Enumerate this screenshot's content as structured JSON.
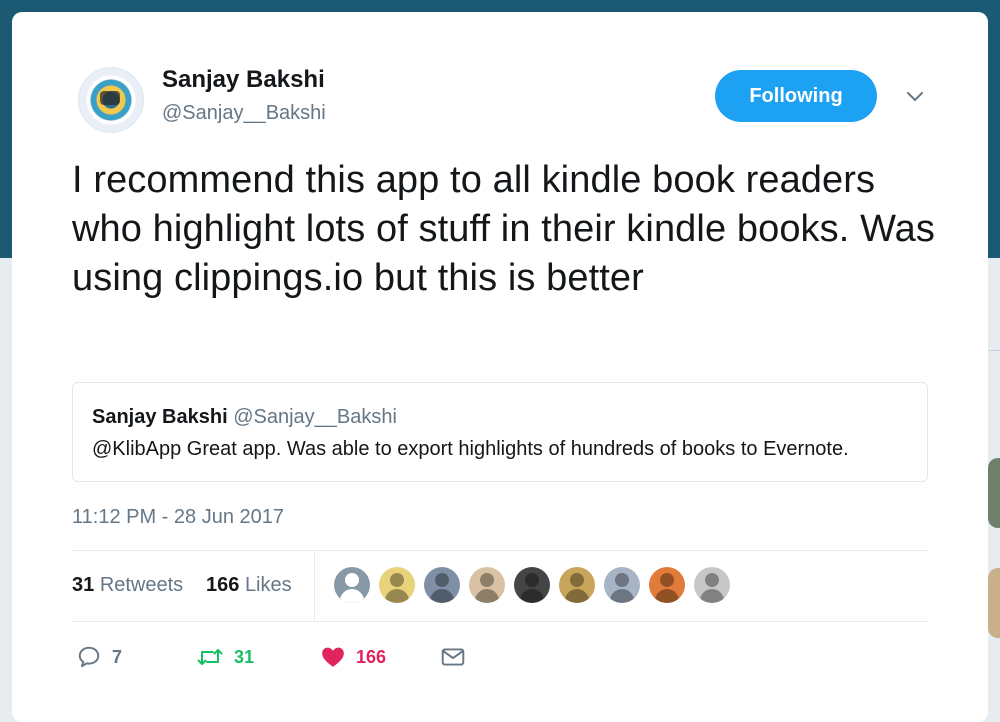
{
  "tweet": {
    "author": {
      "name": "Sanjay Bakshi",
      "handle": "@Sanjay__Bakshi"
    },
    "follow_button_label": "Following",
    "text": "I recommend this app to all kindle book readers who highlight lots of stuff in their kindle books. Was using clippings.io but this is better",
    "quoted": {
      "name": "Sanjay Bakshi",
      "handle": "@Sanjay__Bakshi",
      "text": "@KlibApp Great app. Was able to export highlights of hundreds of books to Evernote."
    },
    "timestamp": "11:12 PM - 28 Jun 2017",
    "stats": {
      "retweets_count": "31",
      "retweets_label": "Retweets",
      "likes_count": "166",
      "likes_label": "Likes"
    },
    "likers": [
      {
        "color": "#8899a6"
      },
      {
        "color": "#e8d27a"
      },
      {
        "color": "#7f8fa6"
      },
      {
        "color": "#d9c2a4"
      },
      {
        "color": "#444444"
      },
      {
        "color": "#c8a55a"
      },
      {
        "color": "#a7b4c6"
      },
      {
        "color": "#e07b39"
      },
      {
        "color": "#c7c7c7"
      }
    ],
    "actions": {
      "reply_count": "7",
      "retweet_count": "31",
      "like_count": "166"
    }
  },
  "colors": {
    "brand_blue": "#1da1f2",
    "retweet_green": "#17bf63",
    "like_red": "#e0245e",
    "muted_text": "#657786",
    "header_background": "#1b5a72"
  },
  "icons": {
    "caret": "chevron-down-icon",
    "reply": "reply-icon",
    "retweet": "retweet-icon",
    "like": "heart-icon",
    "dm": "envelope-icon"
  }
}
